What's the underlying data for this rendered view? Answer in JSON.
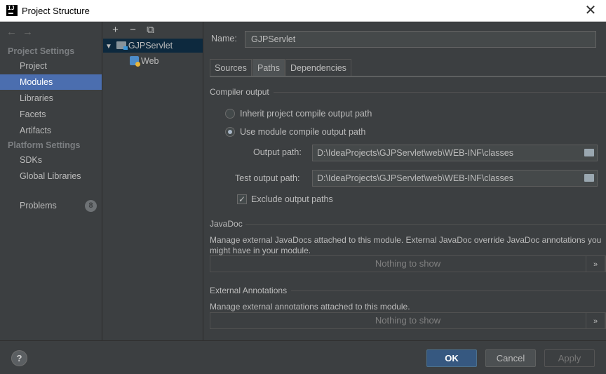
{
  "window": {
    "title": "Project Structure",
    "close_symbol": "✕"
  },
  "nav": {
    "back_symbol": "←",
    "forward_symbol": "→"
  },
  "sidebar": {
    "project_settings_header": "Project Settings",
    "project_settings_items": [
      "Project",
      "Modules",
      "Libraries",
      "Facets",
      "Artifacts"
    ],
    "selected": "Modules",
    "platform_settings_header": "Platform Settings",
    "platform_settings_items": [
      "SDKs",
      "Global Libraries"
    ],
    "problems_label": "Problems",
    "problems_count": "8"
  },
  "tree": {
    "toolbar": {
      "add": "+",
      "remove": "−",
      "copy": "⧉"
    },
    "expand_symbol": "▼",
    "module_name": "GJPServlet",
    "facet_name": "Web"
  },
  "module": {
    "name_label": "Name:",
    "name_value": "GJPServlet",
    "tabs": [
      "Sources",
      "Paths",
      "Dependencies"
    ],
    "active_tab": "Paths"
  },
  "compiler_output": {
    "header": "Compiler output",
    "inherit_label": "Inherit project compile output path",
    "use_module_label": "Use module compile output path",
    "selected_option": "Use module compile output path",
    "output_path_label": "Output path:",
    "output_path_value": "D:\\IdeaProjects\\GJPServlet\\web\\WEB-INF\\classes",
    "test_output_path_label": "Test output path:",
    "test_output_path_value": "D:\\IdeaProjects\\GJPServlet\\web\\WEB-INF\\classes",
    "exclude_label": "Exclude output paths",
    "exclude_checked": true
  },
  "javadoc": {
    "header": "JavaDoc",
    "description": "Manage external JavaDocs attached to this module. External JavaDoc override JavaDoc annotations you might have in your module.",
    "empty_text": "Nothing to show",
    "expand_symbol": "»"
  },
  "external_annotations": {
    "header": "External Annotations",
    "description": "Manage external annotations attached to this module.",
    "empty_text": "Nothing to show",
    "expand_symbol": "»"
  },
  "footer": {
    "help_symbol": "?",
    "ok_label": "OK",
    "cancel_label": "Cancel",
    "apply_label": "Apply"
  }
}
